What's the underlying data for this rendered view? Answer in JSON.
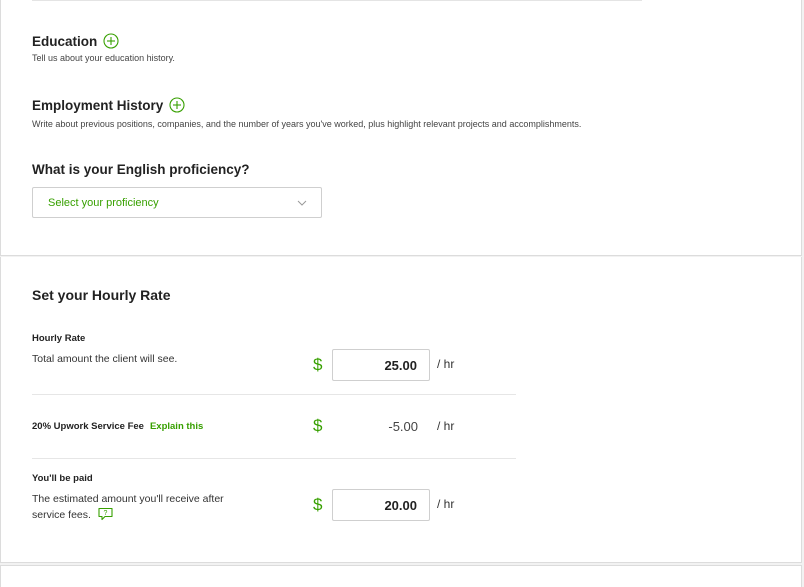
{
  "profile": {
    "education": {
      "title": "Education",
      "subtitle": "Tell us about your education history."
    },
    "employment": {
      "title": "Employment History",
      "subtitle": "Write about previous positions, companies, and the number of years you've worked, plus highlight relevant projects and accomplishments."
    },
    "english": {
      "question": "What is your English proficiency?",
      "select_placeholder": "Select your proficiency"
    }
  },
  "rate": {
    "title": "Set your Hourly Rate",
    "hourly": {
      "label": "Hourly Rate",
      "description": "Total amount the client will see.",
      "currency": "$",
      "value": "25.00",
      "unit": "/ hr"
    },
    "fee": {
      "label": "20% Upwork Service Fee",
      "link": "Explain this",
      "currency": "$",
      "value": "-5.00",
      "unit": "/ hr"
    },
    "paid": {
      "label": "You'll be paid",
      "description_line1": "The estimated amount you'll receive after",
      "description_line2": "service fees.",
      "currency": "$",
      "value": "20.00",
      "unit": "/ hr"
    }
  },
  "colors": {
    "accent": "#37a000",
    "border": "#cfcfcf"
  },
  "icons": {
    "add": "plus-circle-icon",
    "dropdown": "chevron-down-icon",
    "help": "speech-bubble-question-icon"
  }
}
